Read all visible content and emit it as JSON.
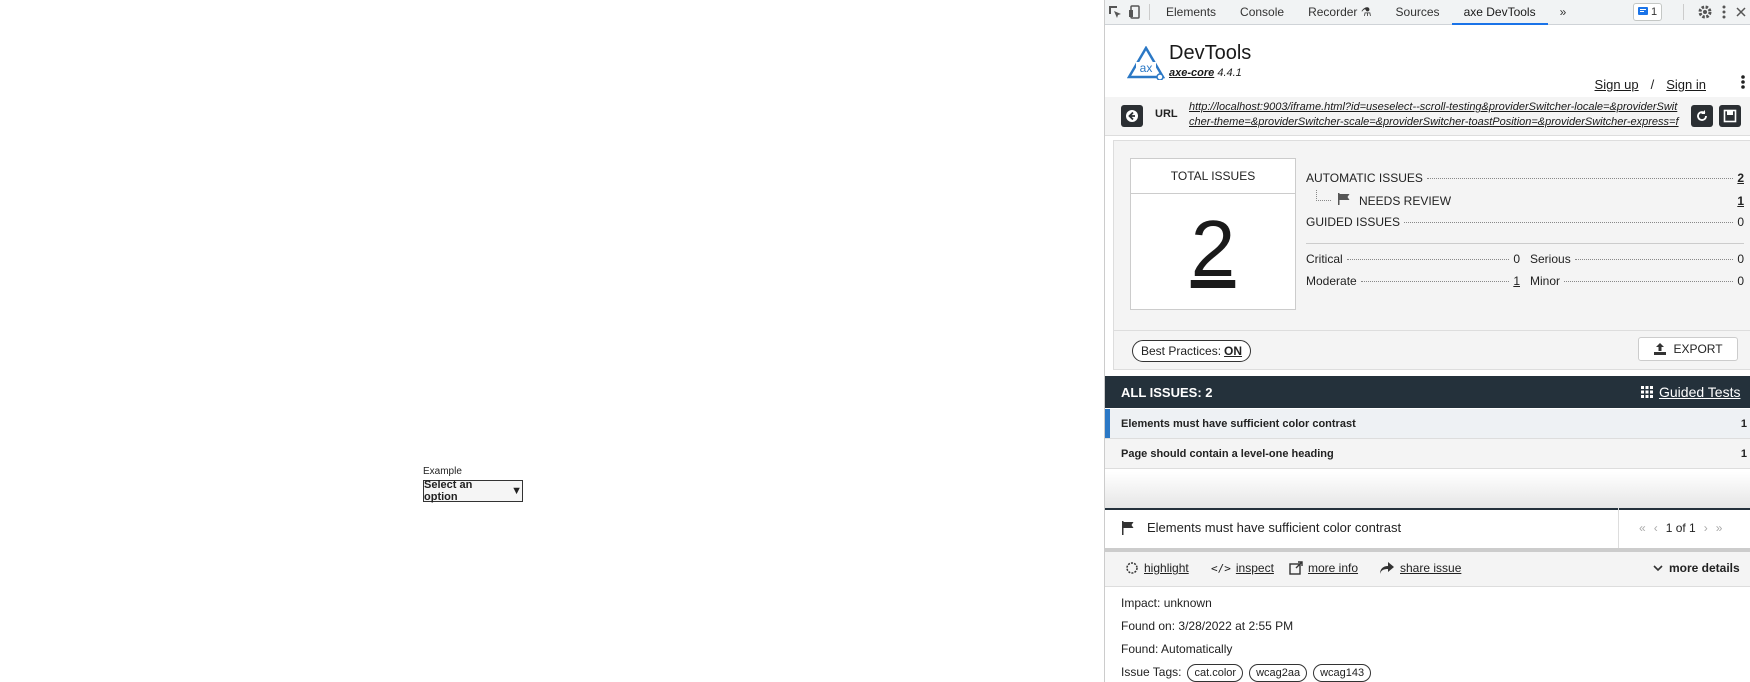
{
  "page": {
    "example_label": "Example",
    "select_value": "Select an option",
    "select_arrow": "▼"
  },
  "devtools": {
    "tabs": [
      "Elements",
      "Console",
      "Recorder",
      "Sources",
      "axe DevTools"
    ],
    "more_tabs": "»",
    "issues_badge_count": "1",
    "brand_title": "DevTools",
    "brand_core": "axe-core",
    "brand_version": "4.4.1",
    "sign_up": "Sign up",
    "sign_in": "Sign in",
    "auth_sep": "/",
    "url_label": "URL",
    "url": "http://localhost:9003/iframe.html?id=useselect--scroll-testing&providerSwitcher-locale=&providerSwitcher-theme=&providerSwitcher-scale=&providerSwitcher-toastPosition=&providerSwitcher-express=false&viewMode=story",
    "summary": {
      "total_label": "TOTAL ISSUES",
      "total_value": "2",
      "automatic_label": "AUTOMATIC ISSUES",
      "automatic_value": "2",
      "needs_review_label": "NEEDS REVIEW",
      "needs_review_value": "1",
      "guided_label": "GUIDED ISSUES",
      "guided_value": "0",
      "critical_label": "Critical",
      "critical_value": "0",
      "serious_label": "Serious",
      "serious_value": "0",
      "moderate_label": "Moderate",
      "moderate_value": "1",
      "minor_label": "Minor",
      "minor_value": "0",
      "best_practices_label": "Best Practices:",
      "best_practices_value": "ON",
      "export_label": "EXPORT"
    },
    "all_issues_label": "ALL ISSUES: 2",
    "guided_tests_label": "Guided Tests",
    "issues": [
      {
        "title": "Elements must have sufficient color contrast",
        "count": "1"
      },
      {
        "title": "Page should contain a level-one heading",
        "count": "1"
      }
    ],
    "detail": {
      "title": "Elements must have sufficient color contrast",
      "pager": "1 of 1",
      "actions": {
        "highlight": "highlight",
        "inspect": "inspect",
        "more_info": "more info",
        "share_issue": "share issue",
        "more_details": "more details"
      },
      "impact_label": "Impact:",
      "impact_value": "unknown",
      "found_on_label": "Found on:",
      "found_on_value": "3/28/2022 at 2:55 PM",
      "found_label": "Found:",
      "found_value": "Automatically",
      "tags_label": "Issue Tags:",
      "tags": [
        "cat.color",
        "wcag2aa",
        "wcag143"
      ]
    }
  },
  "colors": {
    "accent": "#1a73e8",
    "dark_bar": "#24313b",
    "selected_marker": "#2b78c5",
    "logo_blue": "#2b78c5"
  }
}
